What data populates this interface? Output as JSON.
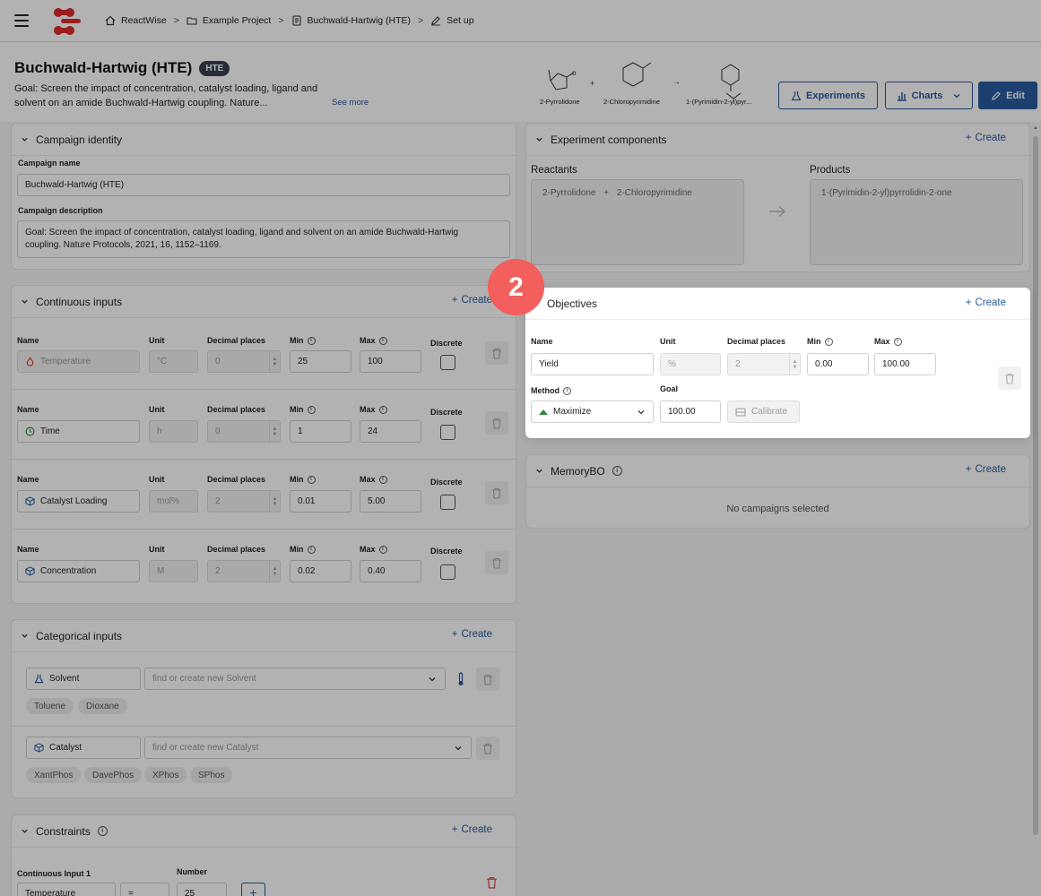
{
  "breadcrumb": [
    "ReactWise",
    "Example Project",
    "Buchwald-Hartwig (HTE)",
    "Set up"
  ],
  "header": {
    "title": "Buchwald-Hartwig (HTE)",
    "badge": "HTE",
    "goal": "Goal: Screen the impact of concentration, catalyst loading, ligand and solvent on an amide Buchwald-Hartwig coupling. Nature...",
    "see_more": "See more",
    "reaction_labels": [
      "2-Pyrrolidone",
      "2-Chloropyrimidine",
      "1-(Pyrimidin-2-yl)pyr..."
    ],
    "buttons": {
      "experiments": "Experiments",
      "charts": "Charts",
      "edit": "Edit"
    }
  },
  "identity": {
    "title": "Campaign identity",
    "name_label": "Campaign name",
    "name_value": "Buchwald-Hartwig (HTE)",
    "desc_label": "Campaign description",
    "desc_line1": "Goal: Screen the impact of concentration, catalyst loading, ligand and solvent on an amide Buchwald-Hartwig",
    "desc_line2": "coupling. Nature Protocols, 2021, 16, 1152–1169."
  },
  "continuous": {
    "title": "Continuous inputs",
    "create": "Create",
    "col_labels": {
      "name": "Name",
      "unit": "Unit",
      "decimals": "Decimal places",
      "min": "Min",
      "max": "Max",
      "discrete": "Discrete"
    },
    "rows": [
      {
        "name": "Temperature",
        "unit": "°C",
        "decimals": "0",
        "min": "25",
        "max": "100"
      },
      {
        "name": "Time",
        "unit": "h",
        "decimals": "0",
        "min": "1",
        "max": "24"
      },
      {
        "name": "Catalyst Loading",
        "unit": "mol%",
        "decimals": "2",
        "min": "0.01",
        "max": "5.00"
      },
      {
        "name": "Concentration",
        "unit": "M",
        "decimals": "2",
        "min": "0.02",
        "max": "0.40"
      }
    ]
  },
  "categorical": {
    "title": "Categorical inputs",
    "create": "Create",
    "groups": [
      {
        "name": "Solvent",
        "placeholder": "find or create new Solvent",
        "chips": [
          "Toluene",
          "Dioxane"
        ]
      },
      {
        "name": "Catalyst",
        "placeholder": "find or create new Catalyst",
        "chips": [
          "XantPhos",
          "DavePhos",
          "XPhos",
          "SPhos"
        ]
      }
    ]
  },
  "constraints": {
    "title": "Constraints",
    "create": "Create",
    "input_label": "Continuous Input 1",
    "input_value": "Temperature",
    "op_value": "=",
    "number_label": "Number",
    "number_value": "25"
  },
  "components": {
    "title": "Experiment components",
    "create": "Create",
    "reactants_label": "Reactants",
    "reactants": [
      "2-Pyrrolidone",
      "2-Chloropyrimidine"
    ],
    "products_label": "Products",
    "product": "1-(Pyrimidin-2-yl)pyrrolidin-2-one"
  },
  "objectives": {
    "title": "Objectives",
    "create": "Create",
    "labels": {
      "name": "Name",
      "unit": "Unit",
      "decimals": "Decimal places",
      "min": "Min",
      "max": "Max",
      "method": "Method",
      "goal": "Goal"
    },
    "name": "Yield",
    "unit": "%",
    "decimals": "2",
    "min": "0.00",
    "max": "100.00",
    "method": "Maximize",
    "goal": "100.00",
    "calibrate": "Calibrate"
  },
  "memorybo": {
    "title": "MemoryBO",
    "create": "Create",
    "empty": "No campaigns selected"
  },
  "step": "2",
  "colors": {
    "accent": "#2a5b9e",
    "step": "#f25f5c",
    "maximize": "#2e8b3e",
    "delete": "#d9534f"
  }
}
